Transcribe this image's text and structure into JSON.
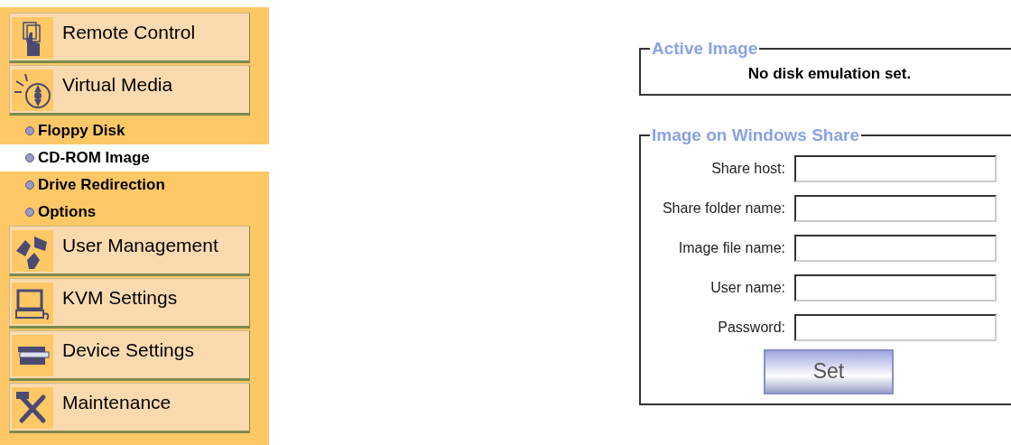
{
  "menu": [
    {
      "kind": "section",
      "label": "Remote Control"
    },
    {
      "kind": "section",
      "label": "Virtual Media"
    },
    {
      "kind": "subitem",
      "label": "Floppy Disk",
      "selected": false
    },
    {
      "kind": "subitem",
      "label": "CD-ROM Image",
      "selected": true
    },
    {
      "kind": "subitem",
      "label": "Drive Redirection",
      "selected": false
    },
    {
      "kind": "subitem",
      "label": "Options",
      "selected": false
    },
    {
      "kind": "section",
      "label": "User Management"
    },
    {
      "kind": "section",
      "label": "KVM Settings"
    },
    {
      "kind": "section",
      "label": "Device Settings"
    },
    {
      "kind": "section",
      "label": "Maintenance"
    }
  ],
  "active_image": {
    "legend": "Active Image",
    "message": "No disk emulation set."
  },
  "windows_share": {
    "legend": "Image on Windows Share",
    "fields": [
      {
        "label": "Share host:"
      },
      {
        "label": "Share folder name:"
      },
      {
        "label": "Image file name:"
      },
      {
        "label": "User name:"
      },
      {
        "label": "Password:"
      }
    ],
    "button": "Set"
  }
}
